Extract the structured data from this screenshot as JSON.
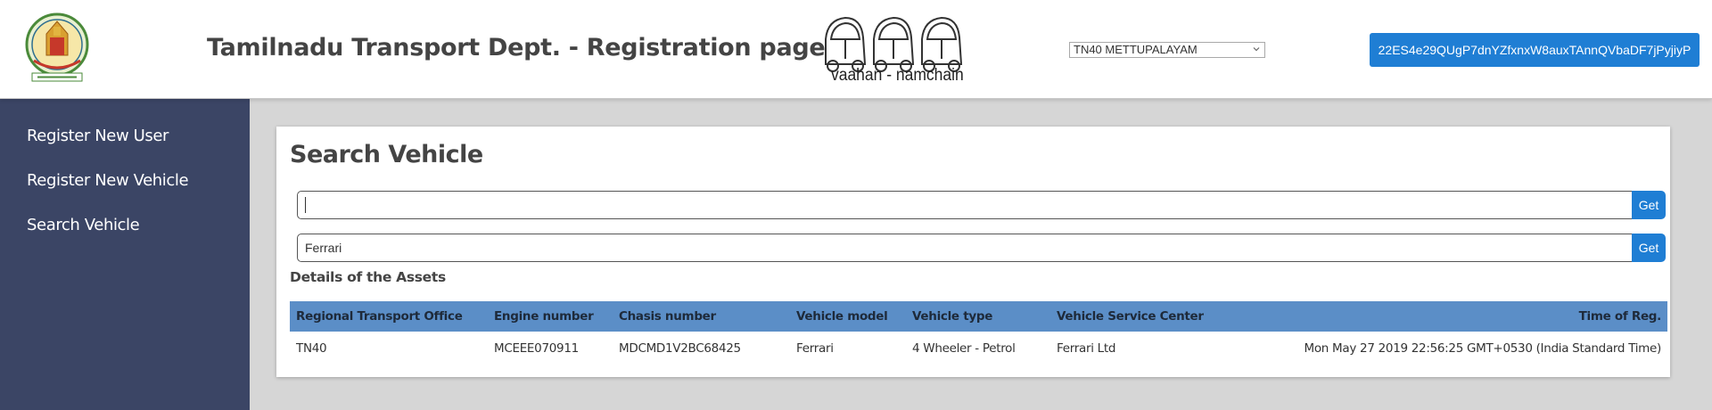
{
  "header": {
    "title": "Tamilnadu Transport Dept. - Registration page",
    "logo_text": "vaahan - namchain",
    "rto_select": {
      "value": "TN40 METTUPALAYAM"
    },
    "account_address": "22ES4e29QUgP7dnYZfxnxW8auxTAnnQVbaDF7jPyjiyP"
  },
  "sidebar": {
    "items": [
      {
        "label": "Register New User"
      },
      {
        "label": "Register New Vehicle"
      },
      {
        "label": "Search Vehicle"
      }
    ]
  },
  "main": {
    "title": "Search Vehicle",
    "search1": {
      "value": "",
      "button": "Get"
    },
    "search2": {
      "value": "Ferrari",
      "button": "Get"
    },
    "section_title": "Details of the Assets",
    "table": {
      "headers": [
        "Regional Transport Office",
        "Engine number",
        "Chasis number",
        "Vehicle model",
        "Vehicle type",
        "Vehicle Service Center",
        "Time of Reg."
      ],
      "rows": [
        [
          "TN40",
          "MCEEE070911",
          "MDCMD1V2BC68425",
          "Ferrari",
          "4 Wheeler - Petrol",
          "Ferrari Ltd",
          "Mon May 27 2019 22:56:25 GMT+0530 (India Standard Time)"
        ]
      ]
    }
  },
  "colors": {
    "accent": "#1f7ed4",
    "sidebar_bg": "#3b4565",
    "table_header_bg": "#5b8ec7",
    "page_bg": "#d6d6d6"
  },
  "icons": {
    "emblem": "tamilnadu-emblem-icon",
    "logo": "cars-logo-icon",
    "dropdown": "chevron-down-icon"
  }
}
